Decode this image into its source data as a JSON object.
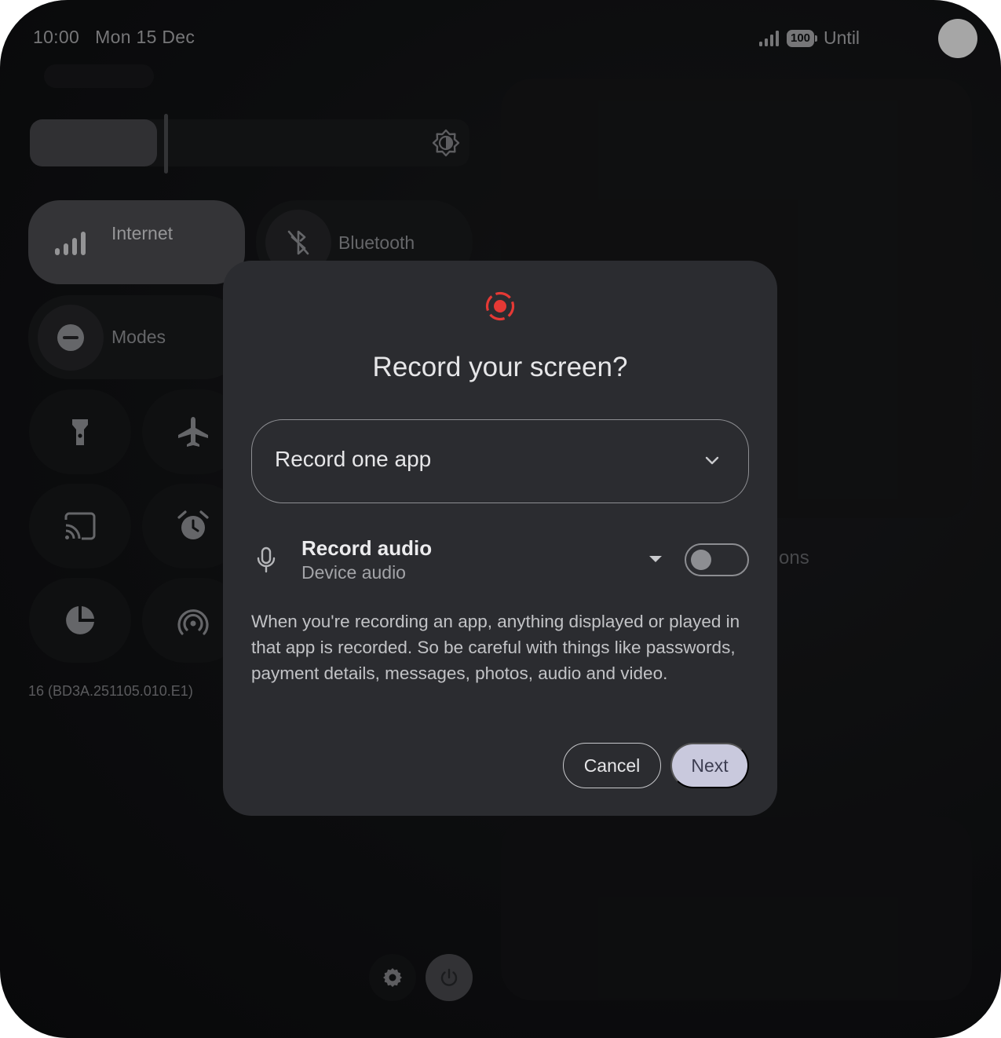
{
  "status_bar": {
    "time": "10:00",
    "date": "Mon 15 Dec",
    "battery": "100",
    "until_text": "Until"
  },
  "quick_settings": {
    "tiles": {
      "internet": "Internet",
      "bluetooth": "Bluetooth",
      "modes": "Modes"
    },
    "build_number": "16 (BD3A.251105.010.E1)",
    "partial_label": "ons"
  },
  "dialog": {
    "title": "Record your screen?",
    "dropdown_value": "Record one app",
    "audio_title": "Record audio",
    "audio_source": "Device audio",
    "audio_enabled": false,
    "warning": "When you're recording an app, anything displayed or played in that app is recorded. So be careful with things like passwords, payment details, messages, photos, audio and video.",
    "cancel_label": "Cancel",
    "next_label": "Next",
    "accent_color": "#e53935"
  }
}
